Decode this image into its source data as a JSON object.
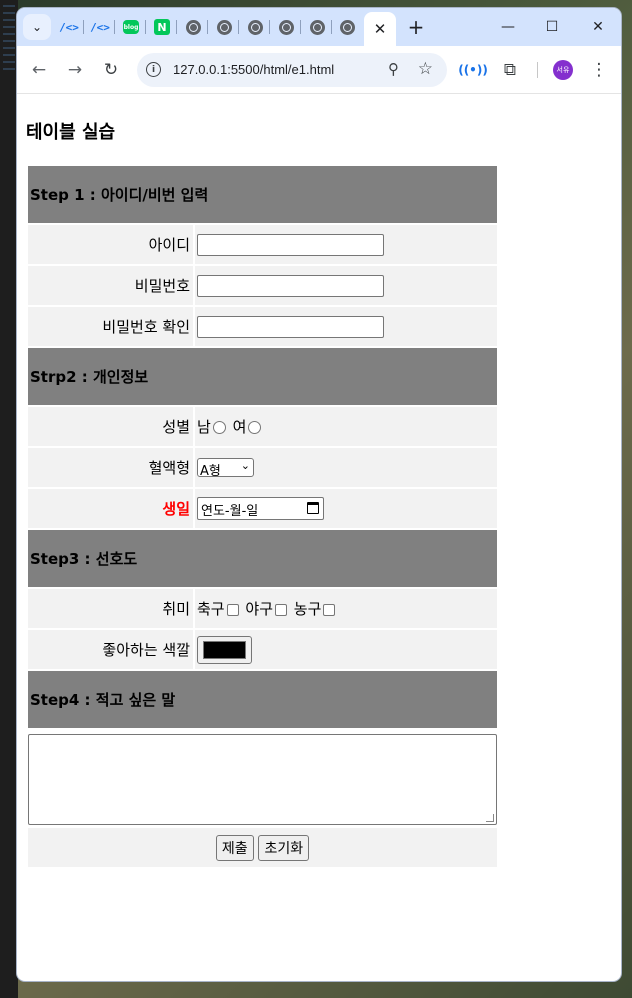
{
  "browser": {
    "tabs": {
      "dropdown_icon": "chevron-down-icon",
      "mini_tab_icons": [
        "code-icon",
        "code-icon",
        "blog-icon",
        "naver-icon",
        "globe-icon",
        "globe-icon",
        "globe-icon",
        "globe-icon",
        "globe-icon",
        "globe-icon"
      ],
      "blog_text": "blog",
      "naver_text": "N",
      "code_text": "/<>",
      "active_close": "✕",
      "new_tab": "+"
    },
    "window_controls": {
      "minimize": "—",
      "maximize": "☐",
      "close": "✕"
    },
    "toolbar": {
      "back": "←",
      "forward": "→",
      "reload": "↻",
      "url": "127.0.0.1:5500/html/e1.html",
      "avatar_text": "서유",
      "menu": "⋮"
    }
  },
  "page": {
    "title": "테이블 실습",
    "sections": {
      "step1": "Step 1 : 아이디/비번 입력",
      "step2": "Strp2 : 개인정보",
      "step3": "Step3 : 선호도",
      "step4": "Step4 : 적고 싶은 말"
    },
    "fields": {
      "id_label": "아이디",
      "pw_label": "비밀번호",
      "pw_confirm_label": "비밀번호 확인",
      "gender_label": "성별",
      "gender_male": "남",
      "gender_female": "여",
      "blood_label": "혈액형",
      "blood_value": "A형",
      "birthday_label": "생일",
      "birthday_placeholder": "연도-월-일",
      "hobby_label": "취미",
      "hobby_soccer": "축구",
      "hobby_baseball": "야구",
      "hobby_basketball": "농구",
      "color_label": "좋아하는 색깔",
      "color_value": "#000000"
    },
    "buttons": {
      "submit": "제출",
      "reset": "초기화"
    }
  }
}
